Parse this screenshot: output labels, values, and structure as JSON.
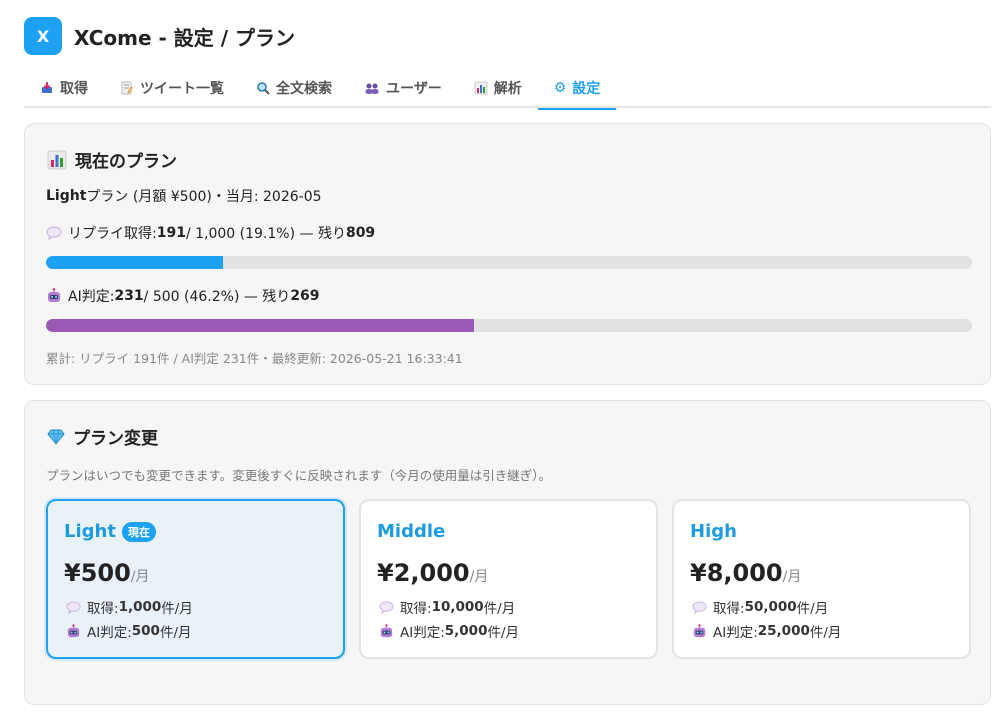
{
  "app": {
    "logo_letter": "X",
    "title": "XCome - 設定 / プラン"
  },
  "tabs": [
    {
      "icon": "inbox-icon",
      "label": "取得"
    },
    {
      "icon": "memo-icon",
      "label": "ツイート一覧"
    },
    {
      "icon": "search-icon",
      "label": "全文検索"
    },
    {
      "icon": "users-icon",
      "label": "ユーザー"
    },
    {
      "icon": "bar-chart-icon",
      "label": "解析"
    },
    {
      "icon": "gear-icon",
      "label": "設定",
      "active": true
    }
  ],
  "current_plan": {
    "title": "現在のプラン",
    "plan_name": "Light",
    "plan_suffix": " プラン (月額 ¥500)・当月: 2026-05",
    "reply": {
      "label": "リプライ取得: ",
      "used": "191",
      "mid": " / 1,000 (19.1%) — 残り ",
      "remaining": "809",
      "fraction": 0.191,
      "color": "#1da1f2"
    },
    "ai": {
      "label": "AI判定: ",
      "used": "231",
      "mid": " / 500 (46.2%) — 残り ",
      "remaining": "269",
      "fraction": 0.462,
      "color": "#9b59b6"
    },
    "footnote": "累計: リプライ 191件 / AI判定 231件・最終更新: 2026-05-21 16:33:41"
  },
  "plan_change": {
    "title": "プラン変更",
    "subtext": "プランはいつでも変更できます。変更後すぐに反映されます（今月の使用量は引き継ぎ）。",
    "plans": [
      {
        "name": "Light",
        "badge": "現在",
        "price": "¥500",
        "per": "/月",
        "fetch_label": "取得: ",
        "fetch_value": "1,000",
        "fetch_unit": " 件/月",
        "ai_label": "AI判定: ",
        "ai_value": "500",
        "ai_unit": " 件/月",
        "current": true
      },
      {
        "name": "Middle",
        "badge": "",
        "price": "¥2,000",
        "per": "/月",
        "fetch_label": "取得: ",
        "fetch_value": "10,000",
        "fetch_unit": " 件/月",
        "ai_label": "AI判定: ",
        "ai_value": "5,000",
        "ai_unit": " 件/月",
        "current": false
      },
      {
        "name": "High",
        "badge": "",
        "price": "¥8,000",
        "per": "/月",
        "fetch_label": "取得: ",
        "fetch_value": "50,000",
        "fetch_unit": " 件/月",
        "ai_label": "AI判定: ",
        "ai_value": "25,000",
        "ai_unit": " 件/月",
        "current": false
      }
    ]
  }
}
